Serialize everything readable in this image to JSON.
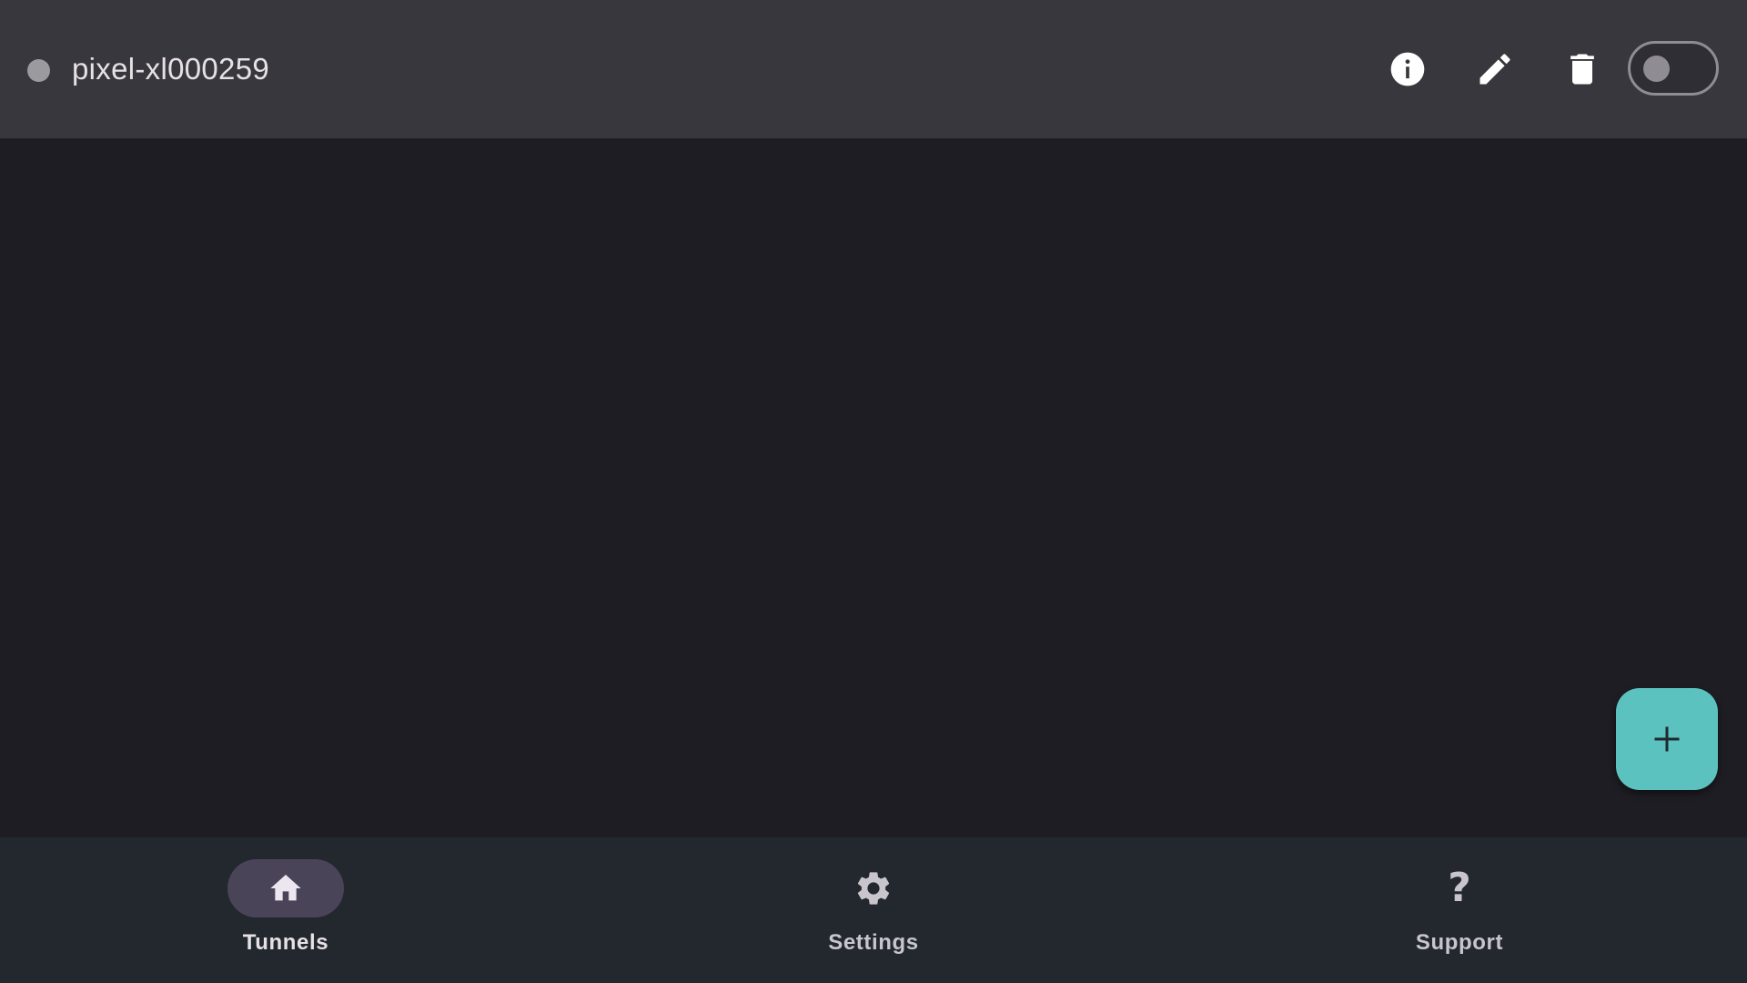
{
  "tunnel": {
    "name": "pixel-xl000259",
    "status_color": "#9b9a9f",
    "enabled": false
  },
  "actions": {
    "info_icon": "info-icon",
    "edit_icon": "pencil-icon",
    "delete_icon": "trash-icon"
  },
  "fab": {
    "icon": "plus-icon",
    "color": "#5cc2c0"
  },
  "bottom_nav": {
    "items": [
      {
        "label": "Tunnels",
        "icon": "home-icon",
        "selected": true
      },
      {
        "label": "Settings",
        "icon": "gear-icon",
        "selected": false
      },
      {
        "label": "Support",
        "icon": "question-mark-icon",
        "selected": false
      }
    ],
    "help_glyph": "?"
  },
  "colors": {
    "background": "#1e1d23",
    "top_bar": "#38373d",
    "nav_background": "#22282d",
    "nav_selected_indicator": "#4a4458"
  }
}
